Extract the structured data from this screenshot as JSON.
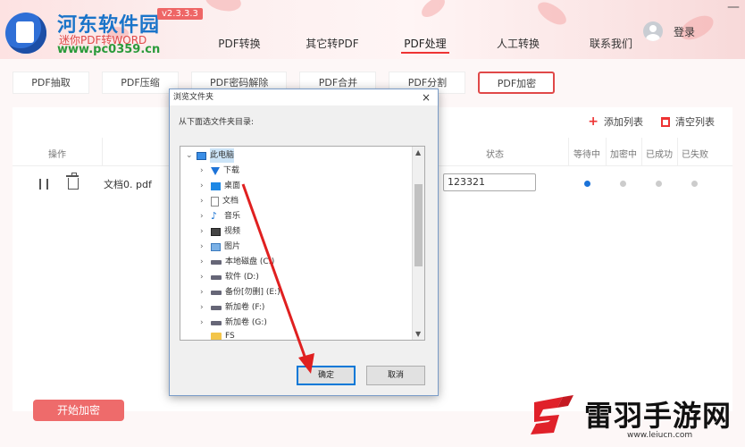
{
  "header": {
    "site_name": "河东软件园",
    "site_sub": "迷你PDF转WORD",
    "site_url": "www.pc0359.cn",
    "version": "v2.3.3.3",
    "nav": [
      "PDF转换",
      "其它转PDF",
      "PDF处理",
      "人工转换",
      "联系我们"
    ],
    "active_nav": "PDF处理",
    "login": "登录",
    "win_min": "—"
  },
  "subtabs": [
    "PDF抽取",
    "PDF压缩",
    "PDF密码解除",
    "PDF合并",
    "PDF分割",
    "PDF加密"
  ],
  "active_subtab": "PDF加密",
  "toolbar": {
    "add": "添加列表",
    "clear": "清空列表"
  },
  "table": {
    "headers": {
      "op": "操作",
      "status": "状态",
      "waiting": "等待中",
      "encrypting": "加密中",
      "success": "已成功",
      "failed": "已失败"
    },
    "rows": [
      {
        "name": "文档0. pdf",
        "password": "123321",
        "state": "等待中"
      }
    ]
  },
  "start_button": "开始加密",
  "dialog": {
    "title": "浏览文件夹",
    "prompt": "从下面选文件夹目录:",
    "close": "×",
    "tree": [
      {
        "label": "此电脑",
        "icon": "pc-icon",
        "arrow": "⌄",
        "selected": true
      },
      {
        "label": "下载",
        "icon": "download-icon",
        "arrow": "›"
      },
      {
        "label": "桌面",
        "icon": "desktop-icon",
        "arrow": "›"
      },
      {
        "label": "文档",
        "icon": "document-icon",
        "arrow": "›"
      },
      {
        "label": "音乐",
        "icon": "music-icon",
        "arrow": "›"
      },
      {
        "label": "视频",
        "icon": "video-icon",
        "arrow": "›"
      },
      {
        "label": "图片",
        "icon": "picture-icon",
        "arrow": "›"
      },
      {
        "label": "本地磁盘 (C:)",
        "icon": "disk-icon",
        "arrow": "›"
      },
      {
        "label": "软件 (D:)",
        "icon": "disk-icon",
        "arrow": "›"
      },
      {
        "label": "备份[勿删] (E:)",
        "icon": "disk-icon",
        "arrow": "›"
      },
      {
        "label": "新加卷 (F:)",
        "icon": "disk-icon",
        "arrow": "›"
      },
      {
        "label": "新加卷 (G:)",
        "icon": "disk-icon",
        "arrow": "›"
      },
      {
        "label": "FS",
        "icon": "folder-icon",
        "arrow": ""
      }
    ],
    "ok": "确定",
    "cancel": "取消"
  },
  "watermark": {
    "text": "雷羽手游网",
    "url": "www.leiucn.com"
  }
}
